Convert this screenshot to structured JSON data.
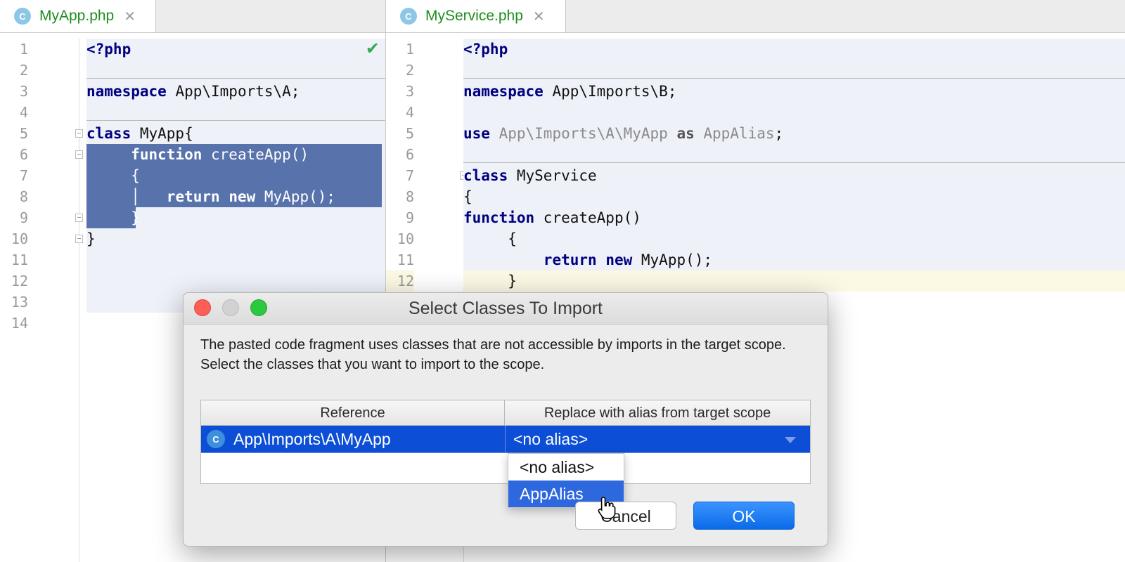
{
  "left_editor": {
    "tab": {
      "icon": "C",
      "name": "MyApp.php",
      "close": "✕"
    },
    "line_numbers": [
      "1",
      "2",
      "3",
      "4",
      "5",
      "6",
      "7",
      "8",
      "9",
      "10",
      "11",
      "12",
      "13",
      "14"
    ],
    "status_check": "✔",
    "code": {
      "l1": "<?php",
      "l3_kw": "namespace",
      "l3_rest": " App\\Imports\\A;",
      "l5_kw": "class",
      "l5_rest": " MyApp{",
      "l6_indent": "     ",
      "l6_kw": "function",
      "l6_rest": " createApp()",
      "l7_indent": "     ",
      "l7_text": "{",
      "l8_indent": "     │   ",
      "l8_kw1": "return",
      "l8_kw2": "new",
      "l8_rest": " MyApp();",
      "l9_indent": "     ",
      "l9_text": "}",
      "l10_text": "}"
    }
  },
  "right_editor": {
    "tab": {
      "icon": "C",
      "name": "MyService.php",
      "close": "✕"
    },
    "line_numbers": [
      "1",
      "2",
      "3",
      "4",
      "5",
      "6",
      "7",
      "8",
      "9",
      "10",
      "11",
      "12"
    ],
    "code": {
      "l1": "<?php",
      "l3_kw": "namespace",
      "l3_rest": " App\\Imports\\B;",
      "l5_kw": "use",
      "l5_path": " App\\Imports\\A\\MyApp ",
      "l5_as": "as",
      "l5_alias": " AppAlias",
      "l5_semi": ";",
      "l7_kw": "class",
      "l7_rest": " MyService",
      "l8_text": "{",
      "l9_kw": "function",
      "l9_rest": " createApp()",
      "l10_text": "     {",
      "l11_indent": "         ",
      "l11_kw1": "return",
      "l11_kw2": "new",
      "l11_rest": " MyApp();",
      "l12_text": "     }"
    }
  },
  "dialog": {
    "title": "Select Classes To Import",
    "message_1": "The pasted code fragment uses classes that are not accessible by imports in the target scope.",
    "message_2": "Select the classes that you want to import to the scope.",
    "table": {
      "columns": [
        "Reference",
        "Replace with alias from target scope"
      ],
      "rows": [
        {
          "icon": "C",
          "reference": "App\\Imports\\A\\MyApp",
          "alias": "<no alias>"
        }
      ]
    },
    "alias_options": [
      "<no alias>",
      "AppAlias"
    ],
    "highlighted_option": "AppAlias",
    "buttons": {
      "cancel": "Cancel",
      "ok": "OK"
    }
  },
  "colors": {
    "selection": "#5872ac",
    "table_selection": "#0c4fd6",
    "ok_button": "#0a6be8",
    "tab_text": "#1f8d1f",
    "keyword": "#000080"
  },
  "icons": {
    "class_badge": "class-c-icon",
    "check": "check-icon",
    "cursor": "hand-pointer-icon"
  }
}
